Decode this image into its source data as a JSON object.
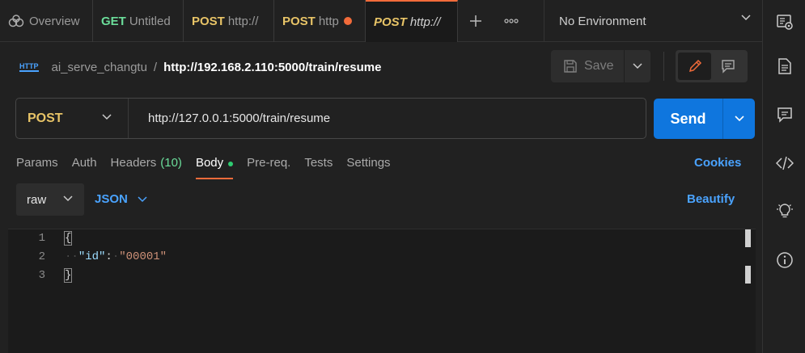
{
  "tabs": [
    {
      "method": "",
      "title": "Overview",
      "icon": "overview-icon"
    },
    {
      "method": "GET",
      "title": "Untitled"
    },
    {
      "method": "POST",
      "title": "http://"
    },
    {
      "method": "POST",
      "title": "http",
      "unsaved": true
    },
    {
      "method": "POST",
      "title": "http://",
      "active": true
    }
  ],
  "tab_actions": {
    "new": "+",
    "more": "ooo"
  },
  "environment": "No Environment",
  "breadcrumb": {
    "badge": "HTTP",
    "collection": "ai_serve_changtu",
    "separator": "/",
    "request": "http://192.168.2.110:5000/train/resume"
  },
  "save": {
    "label": "Save"
  },
  "request": {
    "method": "POST",
    "url": "http://127.0.0.1:5000/train/resume"
  },
  "send": {
    "label": "Send"
  },
  "request_tabs": [
    {
      "label": "Params"
    },
    {
      "label": "Auth"
    },
    {
      "label": "Headers",
      "count": "(10)"
    },
    {
      "label": "Body",
      "active": true
    },
    {
      "label": "Pre-req."
    },
    {
      "label": "Tests"
    },
    {
      "label": "Settings"
    }
  ],
  "cookies": "Cookies",
  "body": {
    "mode": "raw",
    "language": "JSON",
    "beautify": "Beautify"
  },
  "editor": {
    "line_numbers": [
      "1",
      "2",
      "3"
    ],
    "lines": [
      "{",
      "\"id\": \"00001\"",
      "}"
    ],
    "key": "\"id\"",
    "value": "\"00001\""
  },
  "colors": {
    "accent": "#f26b3a",
    "send": "#0f76de",
    "post": "#e8c467",
    "get": "#6bdd9a",
    "link": "#4aa3ff"
  }
}
